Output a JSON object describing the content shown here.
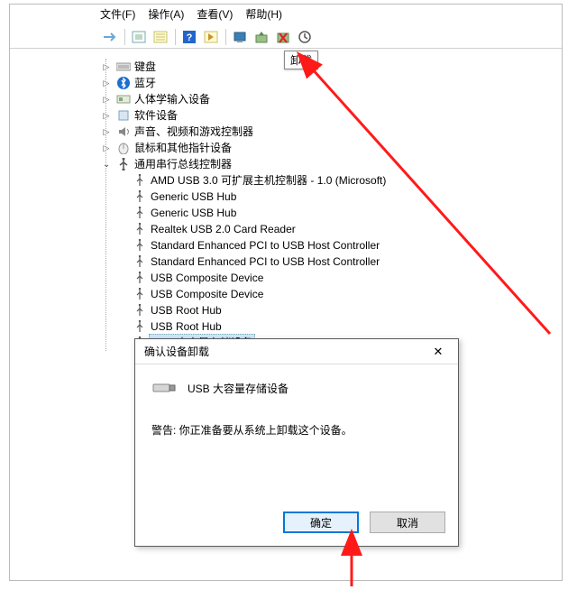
{
  "menubar": {
    "file": "文件(F)",
    "action": "操作(A)",
    "view": "查看(V)",
    "help": "帮助(H)"
  },
  "tooltip": "卸载",
  "tree": {
    "categories": [
      {
        "icon": "keyboard",
        "label": "键盘",
        "expander": ">"
      },
      {
        "icon": "bluetooth",
        "label": "蓝牙",
        "expander": ">"
      },
      {
        "icon": "hid",
        "label": "人体学输入设备",
        "expander": ">"
      },
      {
        "icon": "software",
        "label": "软件设备",
        "expander": ">"
      },
      {
        "icon": "sound",
        "label": "声音、视频和游戏控制器",
        "expander": ">"
      },
      {
        "icon": "mouse",
        "label": "鼠标和其他指针设备",
        "expander": ">"
      },
      {
        "icon": "usb-ctrl",
        "label": "通用串行总线控制器",
        "expander": "v"
      }
    ],
    "usb_children": [
      "AMD USB 3.0 可扩展主机控制器 - 1.0 (Microsoft)",
      "Generic USB Hub",
      "Generic USB Hub",
      "Realtek USB 2.0 Card Reader",
      "Standard Enhanced PCI to USB Host Controller",
      "Standard Enhanced PCI to USB Host Controller",
      "USB Composite Device",
      "USB Composite Device",
      "USB Root Hub",
      "USB Root Hub",
      "USB 大容量存储设备"
    ]
  },
  "dialog": {
    "title": "确认设备卸载",
    "device_name": "USB 大容量存储设备",
    "warning": "警告: 你正准备要从系统上卸载这个设备。",
    "ok": "确定",
    "cancel": "取消"
  }
}
